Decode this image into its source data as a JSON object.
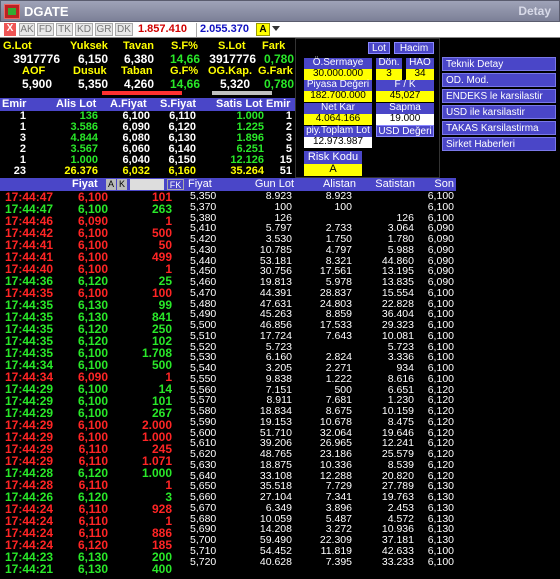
{
  "window": {
    "title": "DGATE",
    "right_title": "Detay"
  },
  "toolbar": {
    "close": "X",
    "buttons": [
      "AK",
      "FD",
      "TK",
      "KD",
      "GR",
      "DK"
    ],
    "value1": "1.857.410",
    "value2": "2.055.370",
    "a_label": "A",
    "colors": {
      "value1": "#d00000",
      "value2": "#1010c0"
    }
  },
  "summary": {
    "row1_labels": [
      "G.Lot",
      "Yuksek",
      "Tavan",
      "S.F%",
      "S.Lot",
      "Fark"
    ],
    "row1_values": [
      "3917776",
      "6,150",
      "6,380",
      "14,66",
      "3917776",
      "0,780"
    ],
    "row2_labels": [
      "AOF",
      "Dusuk",
      "Taban",
      "G.F%",
      "OG.Kap.",
      "G.Fark"
    ],
    "row2_values": [
      "5,900",
      "5,350",
      "4,260",
      "14,66",
      "5,320",
      "0,780"
    ]
  },
  "firm": {
    "lot_button": "Lot",
    "hacim_button": "Hacim",
    "osermaye_label": "Ö.Sermaye",
    "osermaye_value": "30.000.000",
    "don_label": "Dön.",
    "don_value": "3",
    "hao_label": "HAO",
    "hao_value": "34",
    "piyasa_label": "Piyasa Değeri",
    "piyasa_value": "182.700.000",
    "fk_label": "F / K",
    "fk_value": "45,027",
    "netkar_label": "Net Kar",
    "netkar_value": "4.064.166",
    "sapma_label": "Sapma",
    "sapma_value": "19.000",
    "piytoplam_label": "piy.Toplam Lot",
    "piytoplam_value": "12.973.987",
    "usd_button": "USD Değeri",
    "risk_label": "Risk Kodu",
    "risk_value": "A"
  },
  "menu": [
    "Teknik Detay",
    "OD. Mod.",
    "ENDEKS le karsilastir",
    "USD ile karsilastir",
    "TAKAS Karsilastirma",
    "Sirket Haberleri"
  ],
  "depth": {
    "headers": [
      "Emir",
      "Alis Lot",
      "A.Fiyat",
      "S.Fiyat",
      "Satis Lot",
      "Emir"
    ],
    "rows": [
      [
        "1",
        "136",
        "6,100",
        "6,110",
        "1.000",
        "1"
      ],
      [
        "1",
        "3.586",
        "6,090",
        "6,120",
        "1.225",
        "2"
      ],
      [
        "3",
        "4.844",
        "6,080",
        "6,130",
        "1.896",
        "3"
      ],
      [
        "2",
        "3.567",
        "6,060",
        "6,140",
        "6.251",
        "5"
      ],
      [
        "1",
        "1.000",
        "6,040",
        "6,150",
        "12.126",
        "15"
      ],
      [
        "23",
        "26.376",
        "6,032",
        "6,160",
        "35.264",
        "51"
      ]
    ]
  },
  "trades": {
    "header_fiyat": "Fiyat",
    "header_a": "A",
    "header_k": "K",
    "header_fk": "FK",
    "rows": [
      {
        "time": "17:44:47",
        "price": "6,100",
        "lot": "101",
        "c": "red"
      },
      {
        "time": "17:44:47",
        "price": "6,100",
        "lot": "263",
        "c": "green"
      },
      {
        "time": "17:44:46",
        "price": "6,090",
        "lot": "1",
        "c": "red"
      },
      {
        "time": "17:44:42",
        "price": "6,100",
        "lot": "500",
        "c": "red"
      },
      {
        "time": "17:44:41",
        "price": "6,100",
        "lot": "50",
        "c": "red"
      },
      {
        "time": "17:44:41",
        "price": "6,100",
        "lot": "499",
        "c": "red"
      },
      {
        "time": "17:44:40",
        "price": "6,100",
        "lot": "1",
        "c": "red"
      },
      {
        "time": "17:44:36",
        "price": "6,120",
        "lot": "25",
        "c": "green"
      },
      {
        "time": "17:44:35",
        "price": "6,100",
        "lot": "100",
        "c": "red"
      },
      {
        "time": "17:44:35",
        "price": "6,130",
        "lot": "99",
        "c": "green"
      },
      {
        "time": "17:44:35",
        "price": "6,130",
        "lot": "841",
        "c": "green"
      },
      {
        "time": "17:44:35",
        "price": "6,120",
        "lot": "250",
        "c": "green"
      },
      {
        "time": "17:44:35",
        "price": "6,120",
        "lot": "102",
        "c": "green"
      },
      {
        "time": "17:44:35",
        "price": "6,100",
        "lot": "1.708",
        "c": "green"
      },
      {
        "time": "17:44:34",
        "price": "6,100",
        "lot": "500",
        "c": "green"
      },
      {
        "time": "17:44:34",
        "price": "6,090",
        "lot": "1",
        "c": "red"
      },
      {
        "time": "17:44:29",
        "price": "6,100",
        "lot": "14",
        "c": "green"
      },
      {
        "time": "17:44:29",
        "price": "6,100",
        "lot": "101",
        "c": "green"
      },
      {
        "time": "17:44:29",
        "price": "6,100",
        "lot": "267",
        "c": "green"
      },
      {
        "time": "17:44:29",
        "price": "6,100",
        "lot": "2.000",
        "c": "red"
      },
      {
        "time": "17:44:29",
        "price": "6,100",
        "lot": "1.000",
        "c": "red"
      },
      {
        "time": "17:44:29",
        "price": "6,110",
        "lot": "245",
        "c": "red"
      },
      {
        "time": "17:44:29",
        "price": "6,110",
        "lot": "1.071",
        "c": "red"
      },
      {
        "time": "17:44:28",
        "price": "6,120",
        "lot": "1.000",
        "c": "green"
      },
      {
        "time": "17:44:28",
        "price": "6,110",
        "lot": "1",
        "c": "red"
      },
      {
        "time": "17:44:26",
        "price": "6,120",
        "lot": "3",
        "c": "green"
      },
      {
        "time": "17:44:24",
        "price": "6,110",
        "lot": "928",
        "c": "red"
      },
      {
        "time": "17:44:24",
        "price": "6,110",
        "lot": "1",
        "c": "red"
      },
      {
        "time": "17:44:24",
        "price": "6,110",
        "lot": "886",
        "c": "red"
      },
      {
        "time": "17:44:24",
        "price": "6,120",
        "lot": "185",
        "c": "red"
      },
      {
        "time": "17:44:23",
        "price": "6,130",
        "lot": "200",
        "c": "green"
      },
      {
        "time": "17:44:21",
        "price": "6,130",
        "lot": "400",
        "c": "green"
      }
    ]
  },
  "prices": {
    "headers": [
      "Fiyat",
      "Gun Lot",
      "Alistan",
      "Satistan",
      "Son"
    ],
    "rows": [
      [
        "5,350",
        "8.923",
        "8.923",
        "",
        "6,100"
      ],
      [
        "5,370",
        "100",
        "100",
        "",
        "6,100"
      ],
      [
        "5,380",
        "126",
        "",
        "126",
        "6,100"
      ],
      [
        "5,410",
        "5.797",
        "2.733",
        "3.064",
        "6,090"
      ],
      [
        "5,420",
        "3.530",
        "1.750",
        "1.780",
        "6,090"
      ],
      [
        "5,430",
        "10.785",
        "4.797",
        "5.988",
        "6,090"
      ],
      [
        "5,440",
        "53.181",
        "8.321",
        "44.860",
        "6,090"
      ],
      [
        "5,450",
        "30.756",
        "17.561",
        "13.195",
        "6,090"
      ],
      [
        "5,460",
        "19.813",
        "5.978",
        "13.835",
        "6,090"
      ],
      [
        "5,470",
        "44.391",
        "28.837",
        "15.554",
        "6,100"
      ],
      [
        "5,480",
        "47.631",
        "24.803",
        "22.828",
        "6,100"
      ],
      [
        "5,490",
        "45.263",
        "8.859",
        "36.404",
        "6,100"
      ],
      [
        "5,500",
        "46.856",
        "17.533",
        "29.323",
        "6,100"
      ],
      [
        "5,510",
        "17.724",
        "7.643",
        "10.081",
        "6,100"
      ],
      [
        "5,520",
        "5.723",
        "",
        "5.723",
        "6,100"
      ],
      [
        "5,530",
        "6.160",
        "2.824",
        "3.336",
        "6,100"
      ],
      [
        "5,540",
        "3.205",
        "2.271",
        "934",
        "6,100"
      ],
      [
        "5,550",
        "9.838",
        "1.222",
        "8.616",
        "6,100"
      ],
      [
        "5,560",
        "7.151",
        "500",
        "6.651",
        "6,120"
      ],
      [
        "5,570",
        "8.911",
        "7.681",
        "1.230",
        "6,120"
      ],
      [
        "5,580",
        "18.834",
        "8.675",
        "10.159",
        "6,120"
      ],
      [
        "5,590",
        "19.153",
        "10.678",
        "8.475",
        "6,120"
      ],
      [
        "5,600",
        "51.710",
        "32.064",
        "19.646",
        "6,120"
      ],
      [
        "5,610",
        "39.206",
        "26.965",
        "12.241",
        "6,120"
      ],
      [
        "5,620",
        "48.765",
        "23.186",
        "25.579",
        "6,120"
      ],
      [
        "5,630",
        "18.875",
        "10.336",
        "8.539",
        "6,120"
      ],
      [
        "5,640",
        "33.108",
        "12.288",
        "20.820",
        "6,120"
      ],
      [
        "5,650",
        "35.518",
        "7.729",
        "27.789",
        "6,130"
      ],
      [
        "5,660",
        "27.104",
        "7.341",
        "19.763",
        "6,130"
      ],
      [
        "5,670",
        "6.349",
        "3.896",
        "2.453",
        "6,130"
      ],
      [
        "5,680",
        "10.059",
        "5.487",
        "4.572",
        "6,130"
      ],
      [
        "5,690",
        "14.208",
        "3.272",
        "10.936",
        "6,130"
      ],
      [
        "5,700",
        "59.490",
        "22.309",
        "37.181",
        "6,130"
      ],
      [
        "5,710",
        "54.452",
        "11.819",
        "42.633",
        "6,100"
      ],
      [
        "5,720",
        "40.628",
        "7.395",
        "33.233",
        "6,100"
      ]
    ]
  }
}
